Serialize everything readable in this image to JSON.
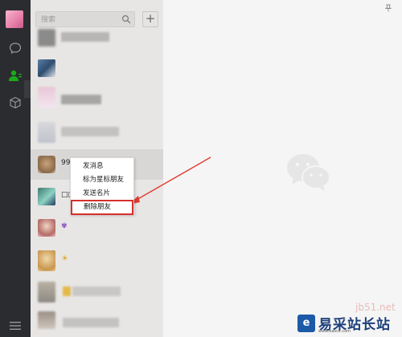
{
  "search": {
    "placeholder": "搜索"
  },
  "toolbar": {
    "add_label": "+"
  },
  "contacts": [
    {
      "label": ""
    },
    {
      "label": ""
    },
    {
      "label": ""
    },
    {
      "label": ""
    },
    {
      "label": "99"
    },
    {
      "label": "□□"
    },
    {
      "label": ""
    },
    {
      "label": ""
    },
    {
      "label": ""
    },
    {
      "label": ""
    }
  ],
  "context_menu": {
    "items": [
      {
        "label": "发消息"
      },
      {
        "label": "标为星标朋友"
      },
      {
        "label": "发送名片"
      },
      {
        "label": "删除朋友"
      }
    ]
  },
  "watermark": {
    "brand": "易采站长站",
    "url": "www.easck.com",
    "faint_text": "jb51.net"
  },
  "colors": {
    "accent_green": "#1aad19",
    "highlight_red": "#d6302b",
    "rail_bg": "#2b2c2f"
  }
}
